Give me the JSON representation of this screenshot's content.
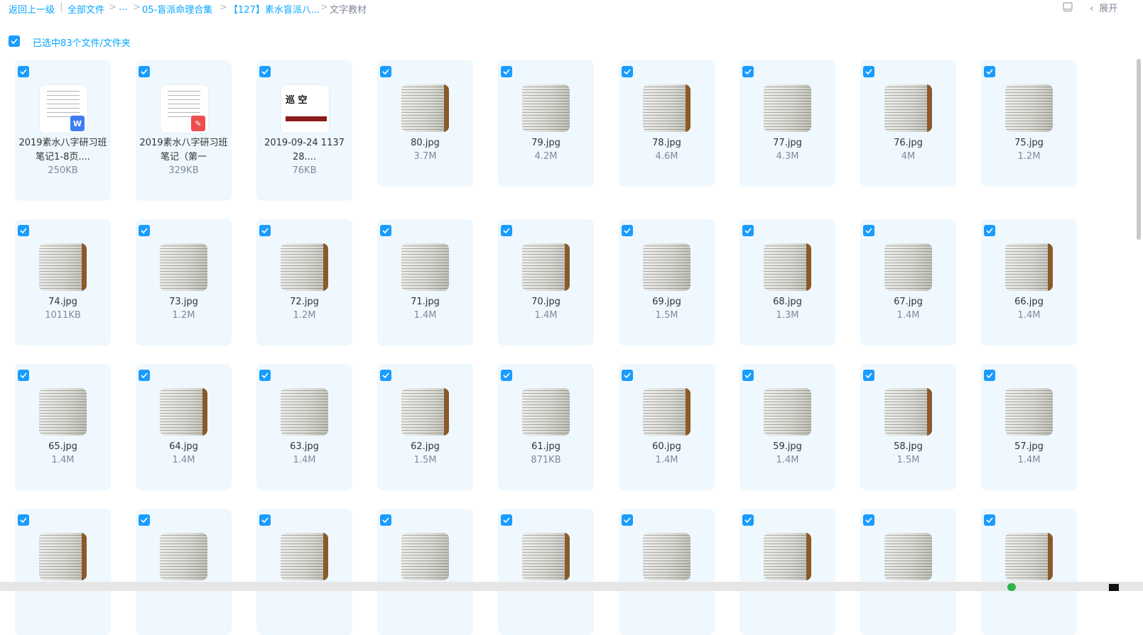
{
  "breadcrumb": {
    "back": "返回上一级",
    "divider": "|",
    "all_files": "全部文件",
    "sep": ">",
    "ellipsis": "...",
    "folder1": "05-盲派命理合集",
    "folder2": "【127】素水盲派八...",
    "current": "文字教材"
  },
  "toolbar": {
    "expand_label": "展开",
    "chevron": "‹"
  },
  "selection": {
    "text": "已选中83个文件/文件夹",
    "checked": true
  },
  "colors": {
    "accent": "#06a7ff",
    "card_bg": "#eef8fe",
    "checkbox": "#1a9cff"
  },
  "files": [
    {
      "name": "2019素水八字研习班笔记1-8页....",
      "size": "250KB",
      "kind": "word"
    },
    {
      "name": "2019素水八字研习班笔记（第一",
      "size": "329KB",
      "kind": "pdf"
    },
    {
      "name": "2019-09-24 1137 28....",
      "size": "76KB",
      "kind": "doc3"
    },
    {
      "name": "80.jpg",
      "size": "3.7M",
      "kind": "jpg"
    },
    {
      "name": "79.jpg",
      "size": "4.2M",
      "kind": "jpg"
    },
    {
      "name": "78.jpg",
      "size": "4.6M",
      "kind": "jpg"
    },
    {
      "name": "77.jpg",
      "size": "4.3M",
      "kind": "jpg"
    },
    {
      "name": "76.jpg",
      "size": "4M",
      "kind": "jpg"
    },
    {
      "name": "75.jpg",
      "size": "1.2M",
      "kind": "jpg"
    },
    {
      "name": "74.jpg",
      "size": "1011KB",
      "kind": "jpg"
    },
    {
      "name": "73.jpg",
      "size": "1.2M",
      "kind": "jpg"
    },
    {
      "name": "72.jpg",
      "size": "1.2M",
      "kind": "jpg"
    },
    {
      "name": "71.jpg",
      "size": "1.4M",
      "kind": "jpg"
    },
    {
      "name": "70.jpg",
      "size": "1.4M",
      "kind": "jpg"
    },
    {
      "name": "69.jpg",
      "size": "1.5M",
      "kind": "jpg"
    },
    {
      "name": "68.jpg",
      "size": "1.3M",
      "kind": "jpg"
    },
    {
      "name": "67.jpg",
      "size": "1.4M",
      "kind": "jpg"
    },
    {
      "name": "66.jpg",
      "size": "1.4M",
      "kind": "jpg"
    },
    {
      "name": "65.jpg",
      "size": "1.4M",
      "kind": "jpg"
    },
    {
      "name": "64.jpg",
      "size": "1.4M",
      "kind": "jpg"
    },
    {
      "name": "63.jpg",
      "size": "1.4M",
      "kind": "jpg"
    },
    {
      "name": "62.jpg",
      "size": "1.5M",
      "kind": "jpg"
    },
    {
      "name": "61.jpg",
      "size": "871KB",
      "kind": "jpg"
    },
    {
      "name": "60.jpg",
      "size": "1.4M",
      "kind": "jpg"
    },
    {
      "name": "59.jpg",
      "size": "1.4M",
      "kind": "jpg"
    },
    {
      "name": "58.jpg",
      "size": "1.5M",
      "kind": "jpg"
    },
    {
      "name": "57.jpg",
      "size": "1.4M",
      "kind": "jpg"
    },
    {
      "name": "",
      "size": "",
      "kind": "jpg"
    },
    {
      "name": "",
      "size": "",
      "kind": "jpg"
    },
    {
      "name": "",
      "size": "",
      "kind": "jpg"
    },
    {
      "name": "",
      "size": "",
      "kind": "jpg"
    },
    {
      "name": "",
      "size": "",
      "kind": "jpg"
    },
    {
      "name": "",
      "size": "",
      "kind": "jpg"
    },
    {
      "name": "",
      "size": "",
      "kind": "jpg"
    },
    {
      "name": "",
      "size": "",
      "kind": "jpg"
    },
    {
      "name": "",
      "size": "",
      "kind": "jpg"
    }
  ],
  "doc_thumb": {
    "title": "巡 空"
  },
  "badges": {
    "word": "W",
    "pdf": "✎"
  }
}
